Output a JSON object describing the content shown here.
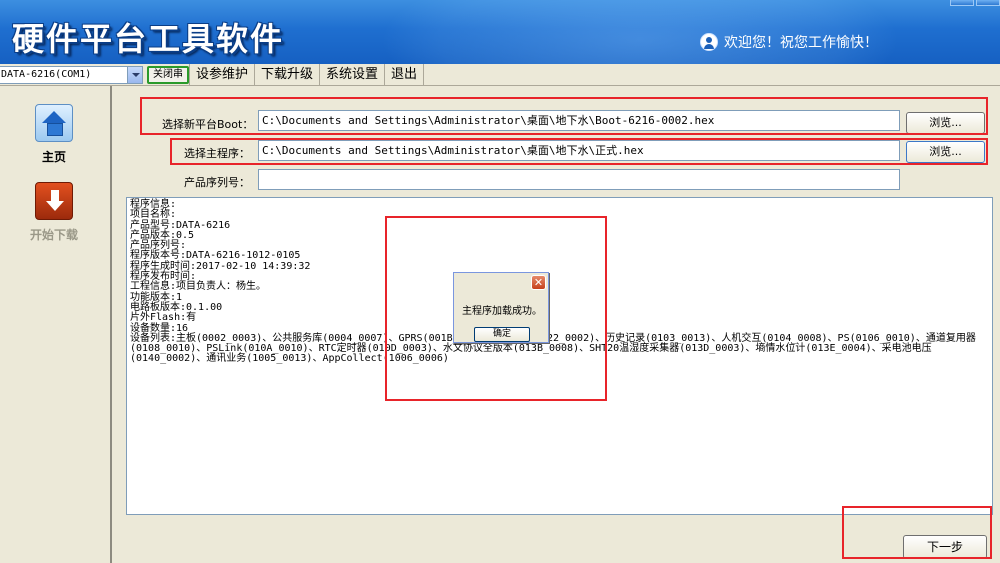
{
  "header": {
    "title": "硬件平台工具软件",
    "welcome": "欢迎您！祝您工作愉快！"
  },
  "toolbar": {
    "device_select": "DATA-6216(COM1)",
    "close_port": "关闭串",
    "menu": [
      "设参维护",
      "下载升级",
      "系统设置",
      "退出"
    ]
  },
  "sidebar": {
    "home_label": "主页",
    "download_label": "开始下载"
  },
  "form": {
    "boot_label": "选择新平台Boot：",
    "boot_path": "C:\\Documents and Settings\\Administrator\\桌面\\地下水\\Boot-6216-0002.hex",
    "main_label": "选择主程序：",
    "main_path": "C:\\Documents and Settings\\Administrator\\桌面\\地下水\\正式.hex",
    "serial_label": "产品序列号：",
    "serial_value": "",
    "browse": "浏览...",
    "next": "下一步"
  },
  "program_info": {
    "lines": [
      "程序信息:",
      "",
      "项目名称:",
      "产品型号:DATA-6216",
      "产品版本:0.5",
      "产品序列号:",
      "程序版本号:DATA-6216-1012-0105",
      "程序生成时间:2017-02-10 14:39:32",
      "程序发布时间:",
      "工程信息:项目负责人：杨生。",
      "功能版本:1",
      "电路板版本:0.1.00",
      "片外Flash:有",
      "设备数量:16",
      "设备列表:主板(0002_0003)、公共服务库(0004_0007)、GPRS(001B_0007)、BOARD(0022_0002)、历史记录(0103_0013)、人机交互(0104_0008)、PS(0106_0010)、通道复用器",
      "(0108_0010)、PSLink(010A_0010)、RTC定时器(010D_0003)、水文协议全版本(013B_0008)、SHT20温湿度采集器(013D_0003)、墒情水位计(013E_0004)、采电池电压",
      "(0140_0002)、通讯业务(1005_0013)、AppCollect(1006_0006)"
    ]
  },
  "dialog": {
    "message": "主程序加载成功。",
    "ok": "确定",
    "close": "✕"
  },
  "colors": {
    "header_blue": "#1f6fd0",
    "annotation_red": "#e8242a",
    "window_bg": "#ece9d8"
  }
}
